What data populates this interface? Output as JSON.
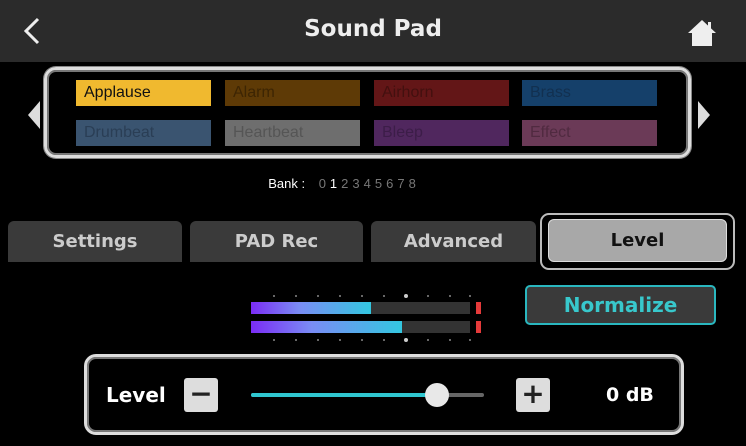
{
  "header": {
    "title": "Sound Pad",
    "back_icon": "chevron-left-icon",
    "home_icon": "home-icon"
  },
  "pads": [
    {
      "label": "Applause",
      "color": "#f0b92f",
      "text": "#111111"
    },
    {
      "label": "Alarm",
      "color": "#5e3a06",
      "text": "#3d2503"
    },
    {
      "label": "Airhorn",
      "color": "#631617",
      "text": "#43100f"
    },
    {
      "label": "Brass",
      "color": "#15406a",
      "text": "#123050"
    },
    {
      "label": "Drumbeat",
      "color": "#3a5470",
      "text": "#2a3e55"
    },
    {
      "label": "Heartbeat",
      "color": "#6e6e6e",
      "text": "#555555"
    },
    {
      "label": "Bleep",
      "color": "#50275e",
      "text": "#3c1d48"
    },
    {
      "label": "Effect",
      "color": "#6b3a57",
      "text": "#502a40"
    }
  ],
  "bank": {
    "label": "Bank :",
    "numbers": [
      "0",
      "1",
      "2",
      "3",
      "4",
      "5",
      "6",
      "7",
      "8"
    ],
    "selected": "1"
  },
  "tabs": [
    "Settings",
    "PAD Rec",
    "Advanced",
    "Level"
  ],
  "selected_tab": "Level",
  "normalize_label": "Normalize",
  "meter": {
    "left_level": 0.55,
    "right_level": 0.69
  },
  "level": {
    "label": "Level",
    "minus": "−",
    "plus": "+",
    "value": "0 dB",
    "slider_fraction": 0.8
  },
  "colors": {
    "accent": "#2ab7bf",
    "meter_peak": "#e53a3a"
  }
}
